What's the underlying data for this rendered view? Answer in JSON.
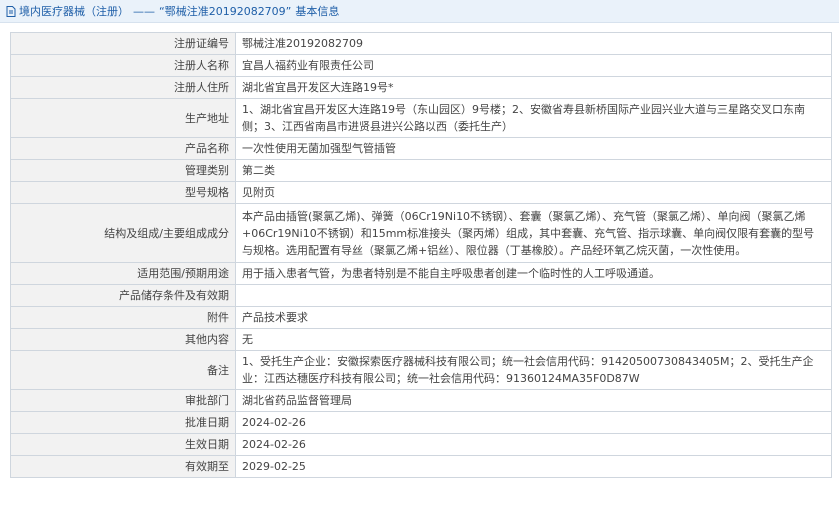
{
  "header": {
    "breadcrumb": "境内医疗器械（注册）",
    "separator": "——",
    "record_title": "“鄂械注准20192082709”",
    "section": "基本信息"
  },
  "rows": [
    {
      "label": "注册证编号",
      "value": "鄂械注准20192082709"
    },
    {
      "label": "注册人名称",
      "value": "宜昌人福药业有限责任公司"
    },
    {
      "label": "注册人住所",
      "value": "湖北省宜昌开发区大连路19号*"
    },
    {
      "label": "生产地址",
      "value": "1、湖北省宜昌开发区大连路19号（东山园区）9号楼；2、安徽省寿县新桥国际产业园兴业大道与三星路交叉口东南侧；3、江西省南昌市进贤县进兴公路以西（委托生产）"
    },
    {
      "label": "产品名称",
      "value": "一次性使用无菌加强型气管插管"
    },
    {
      "label": "管理类别",
      "value": "第二类"
    },
    {
      "label": "型号规格",
      "value": "见附页"
    },
    {
      "label": "结构及组成/主要组成成分",
      "value": "本产品由插管(聚氯乙烯)、弹簧（06Cr19Ni10不锈钢）、套囊（聚氯乙烯）、充气管（聚氯乙烯）、单向阀（聚氯乙烯+06Cr19Ni10不锈钢）和15mm标准接头（聚丙烯）组成，其中套囊、充气管、指示球囊、单向阀仅限有套囊的型号与规格。选用配置有导丝（聚氯乙烯+铝丝）、限位器（丁基橡胶）。产品经环氧乙烷灭菌，一次性使用。"
    },
    {
      "label": "适用范围/预期用途",
      "value": "用于插入患者气管，为患者特别是不能自主呼吸患者创建一个临时性的人工呼吸通道。"
    },
    {
      "label": "产品储存条件及有效期",
      "value": ""
    },
    {
      "label": "附件",
      "value": "产品技术要求"
    },
    {
      "label": "其他内容",
      "value": "无"
    },
    {
      "label": "备注",
      "value": "1、受托生产企业：安徽探索医疗器械科技有限公司；统一社会信用代码：91420500730843405M；2、受托生产企业：江西达穗医疗科技有限公司；统一社会信用代码：91360124MA35F0D87W"
    },
    {
      "label": "审批部门",
      "value": "湖北省药品监督管理局"
    },
    {
      "label": "批准日期",
      "value": "2024-02-26"
    },
    {
      "label": "生效日期",
      "value": "2024-02-26"
    },
    {
      "label": "有效期至",
      "value": "2029-02-25"
    }
  ]
}
